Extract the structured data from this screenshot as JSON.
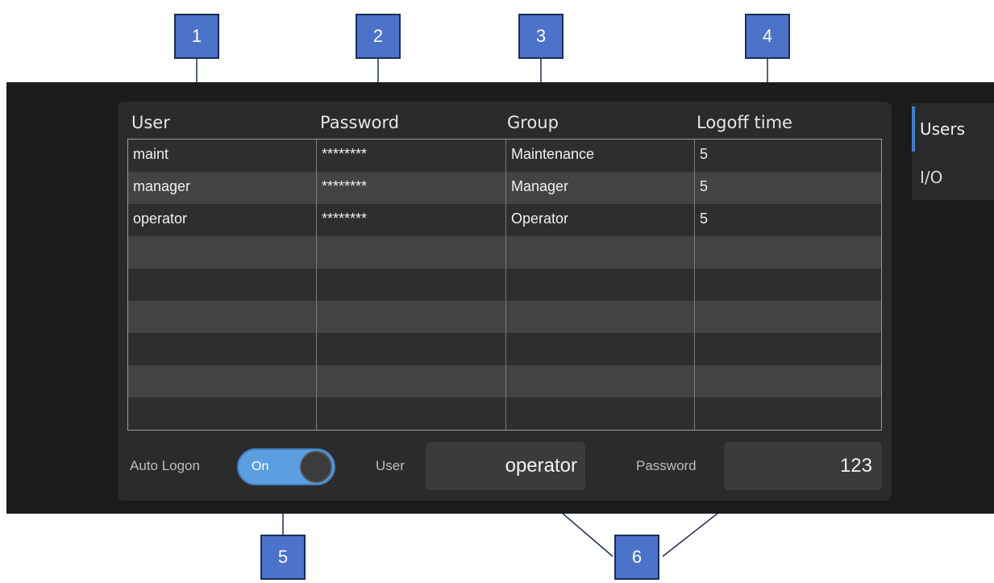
{
  "table": {
    "headers": [
      "User",
      "Password",
      "Group",
      "Logoff time"
    ],
    "rows": [
      [
        "maint",
        "********",
        "Maintenance",
        "5"
      ],
      [
        "manager",
        "********",
        "Manager",
        "5"
      ],
      [
        "operator",
        "********",
        "Operator",
        "5"
      ],
      [
        "",
        "",
        "",
        ""
      ],
      [
        "",
        "",
        "",
        ""
      ],
      [
        "",
        "",
        "",
        ""
      ],
      [
        "",
        "",
        "",
        ""
      ],
      [
        "",
        "",
        "",
        ""
      ],
      [
        "",
        "",
        "",
        ""
      ]
    ]
  },
  "auto_logon": {
    "label": "Auto Logon",
    "toggle_text": "On",
    "user_label": "User",
    "user_value": "operator",
    "password_label": "Password",
    "password_value": "123"
  },
  "side_tabs": [
    "Users",
    "I/O"
  ],
  "callouts": [
    "1",
    "2",
    "3",
    "4",
    "5",
    "6"
  ],
  "colors": {
    "accent": "#5b9fe0",
    "callout_fill": "#4a73c9",
    "panel_bg": "#2b2b2b",
    "screen_bg": "#1b1b1b"
  }
}
